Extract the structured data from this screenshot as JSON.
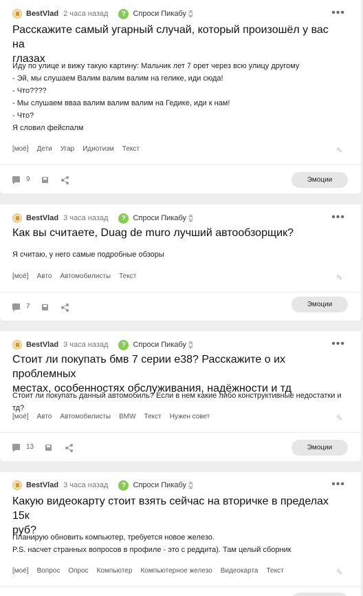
{
  "posts": [
    {
      "author": "BestVlad",
      "time": "2 часа назад",
      "community": "Спроси Пикабу",
      "title_lines": [
        "Расскажите самый угарный случай, который произошёл у вас на",
        "глазах"
      ],
      "body_lines": [
        "Иду по улице и вижу такую картину: Мальчик лет 7 орет через всю улицу другому",
        "- Эй, мы слушаем Валим валим валим на гелике, иди сюда!",
        "- Что????",
        "- Мы слушаем вваа валим валим валим на Гедике, иди к нам!",
        "- Что?",
        "Я словил фейспалм"
      ],
      "tags": [
        "[моё]",
        "Дети",
        "Угар",
        "Идиотизм",
        "Текст"
      ],
      "comments": "9",
      "emotions_label": "Эмоции"
    },
    {
      "author": "BestVlad",
      "time": "3 часа назад",
      "community": "Спроси Пикабу",
      "title_lines": [
        "Как вы считаете, Duag de muro лучший автообзорщик?"
      ],
      "body_lines": [
        "Я считаю, у него самые подробные обзоры"
      ],
      "tags": [
        "[моё]",
        "Авто",
        "Автомобилисты",
        "Текст"
      ],
      "comments": "7",
      "emotions_label": "Эмоции"
    },
    {
      "author": "BestVlad",
      "time": "3 часа назад",
      "community": "Спроси Пикабу",
      "title_lines": [
        "Стоит ли покупать бмв 7 серии е38? Расскажите о их проблемных",
        "местах, особенностях обслуживания, надёжности и тд"
      ],
      "body_lines": [
        "Стоит ли покупать данный автомобиль? Если в нем какие либо конструктивные недостатки и тд?"
      ],
      "tags": [
        "[моё]",
        "Авто",
        "Автомобилисты",
        "BMW",
        "Текст",
        "Нужен совет"
      ],
      "comments": "13",
      "emotions_label": "Эмоции"
    },
    {
      "author": "BestVlad",
      "time": "3 часа назад",
      "community": "Спроси Пикабу",
      "title_lines": [
        "Какую видеокарту стоит взять сейчас на вторичке в пределах 15к",
        "руб?"
      ],
      "body_lines": [
        "Планирую обновить компьютер, требуется новое железо.",
        "P.S. насчет странных вопросов в профиле - это с реддита). Там целый сборник"
      ],
      "tags": [
        "[моё]",
        "Вопрос",
        "Опрос",
        "Компьютер",
        "Компьютерное железо",
        "Видеокарта",
        "Текст"
      ]
    }
  ],
  "icons": {
    "rss": "rss-icon",
    "more": "more-icon",
    "comment": "comment-icon",
    "save": "save-icon",
    "share": "share-icon",
    "edit": "pencil-icon"
  },
  "colors": {
    "community_badge": "#8ac858",
    "page_bg": "#eeeeee",
    "emotions_bg": "#e6e6e6"
  }
}
